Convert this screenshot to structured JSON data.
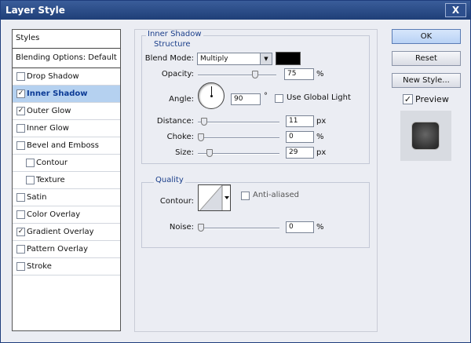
{
  "window": {
    "title": "Layer Style",
    "close_label": "X"
  },
  "styles_list": {
    "header": "Styles",
    "blending": "Blending Options: Default",
    "items": [
      {
        "label": "Drop Shadow",
        "checked": false,
        "selected": false,
        "sub": false
      },
      {
        "label": "Inner Shadow",
        "checked": true,
        "selected": true,
        "sub": false
      },
      {
        "label": "Outer Glow",
        "checked": true,
        "selected": false,
        "sub": false
      },
      {
        "label": "Inner Glow",
        "checked": false,
        "selected": false,
        "sub": false
      },
      {
        "label": "Bevel and Emboss",
        "checked": false,
        "selected": false,
        "sub": false
      },
      {
        "label": "Contour",
        "checked": false,
        "selected": false,
        "sub": true
      },
      {
        "label": "Texture",
        "checked": false,
        "selected": false,
        "sub": true
      },
      {
        "label": "Satin",
        "checked": false,
        "selected": false,
        "sub": false
      },
      {
        "label": "Color Overlay",
        "checked": false,
        "selected": false,
        "sub": false
      },
      {
        "label": "Gradient Overlay",
        "checked": true,
        "selected": false,
        "sub": false
      },
      {
        "label": "Pattern Overlay",
        "checked": false,
        "selected": false,
        "sub": false
      },
      {
        "label": "Stroke",
        "checked": false,
        "selected": false,
        "sub": false
      }
    ]
  },
  "inner_shadow": {
    "section_title": "Inner Shadow",
    "structure_title": "Structure",
    "blend_mode_label": "Blend Mode:",
    "blend_mode_value": "Multiply",
    "shadow_color": "#000000",
    "opacity_label": "Opacity:",
    "opacity_value": "75",
    "opacity_unit": "%",
    "opacity_level": 75,
    "angle_label": "Angle:",
    "angle_value": "90",
    "angle_unit": "°",
    "global_light_label": "Use Global Light",
    "global_light_checked": false,
    "distance_label": "Distance:",
    "distance_value": "11",
    "distance_unit": "px",
    "distance_level": 11,
    "choke_label": "Choke:",
    "choke_value": "0",
    "choke_unit": "%",
    "choke_level": 0,
    "size_label": "Size:",
    "size_value": "29",
    "size_unit": "px",
    "size_level": 29
  },
  "quality": {
    "title": "Quality",
    "contour_label": "Contour:",
    "anti_aliased_label": "Anti-aliased",
    "anti_aliased_checked": false,
    "noise_label": "Noise:",
    "noise_value": "0",
    "noise_unit": "%",
    "noise_level": 0
  },
  "buttons": {
    "ok": "OK",
    "reset": "Reset",
    "new_style": "New Style..."
  },
  "preview": {
    "label": "Preview",
    "checked": true
  }
}
